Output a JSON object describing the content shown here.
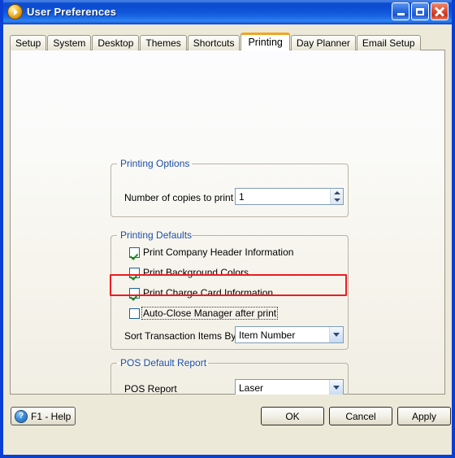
{
  "window": {
    "title": "User Preferences",
    "icon": "orange-play-circle-icon",
    "buttons": {
      "minimize": "minimize-icon",
      "maximize": "maximize-icon",
      "close": "close-icon"
    },
    "accent_title_color": "#0b4bd0",
    "border_color": "#0a3fd6",
    "chrome_color": "#ece9d8"
  },
  "tabs": {
    "items": [
      {
        "label": "Setup",
        "active": false
      },
      {
        "label": "System",
        "active": false
      },
      {
        "label": "Desktop",
        "active": false
      },
      {
        "label": "Themes",
        "active": false
      },
      {
        "label": "Shortcuts",
        "active": false
      },
      {
        "label": "Printing",
        "active": true
      },
      {
        "label": "Day Planner",
        "active": false
      },
      {
        "label": "Email Setup",
        "active": false
      }
    ],
    "active_tab": "Printing",
    "active_tab_accent": "#f0a422"
  },
  "printing_options": {
    "legend": "Printing Options",
    "legend_color": "#1d4ea8",
    "copies": {
      "label": "Number of copies to print",
      "value": "1",
      "up_icon": "arrow-up-icon",
      "down_icon": "arrow-down-icon"
    }
  },
  "printing_defaults": {
    "legend": "Printing Defaults",
    "legend_color": "#1d4ea8",
    "checkboxes": [
      {
        "label": "Print Company Header Information",
        "checked": true,
        "focused": false
      },
      {
        "label": "Print Background Colors",
        "checked": true,
        "focused": false
      },
      {
        "label": "Print Charge Card Information",
        "checked": true,
        "focused": false
      },
      {
        "label": "Auto-Close Manager after print",
        "checked": false,
        "focused": true
      }
    ],
    "sort_by": {
      "label": "Sort Transaction Items By",
      "value": "Item Number",
      "chevron_icon": "chevron-down-icon",
      "highlighted": true,
      "highlight_color": "#ec1c24"
    }
  },
  "pos_default_report": {
    "legend": "POS Default Report",
    "legend_color": "#1d4ea8",
    "report": {
      "label": "POS Report",
      "value": "Laser",
      "chevron_icon": "chevron-down-icon"
    }
  },
  "footer": {
    "help_button": {
      "label": "F1 - Help",
      "icon": "help-question-icon",
      "glyph": "?"
    },
    "ok_button": "OK",
    "cancel_button": "Cancel",
    "apply_button": "Apply"
  }
}
